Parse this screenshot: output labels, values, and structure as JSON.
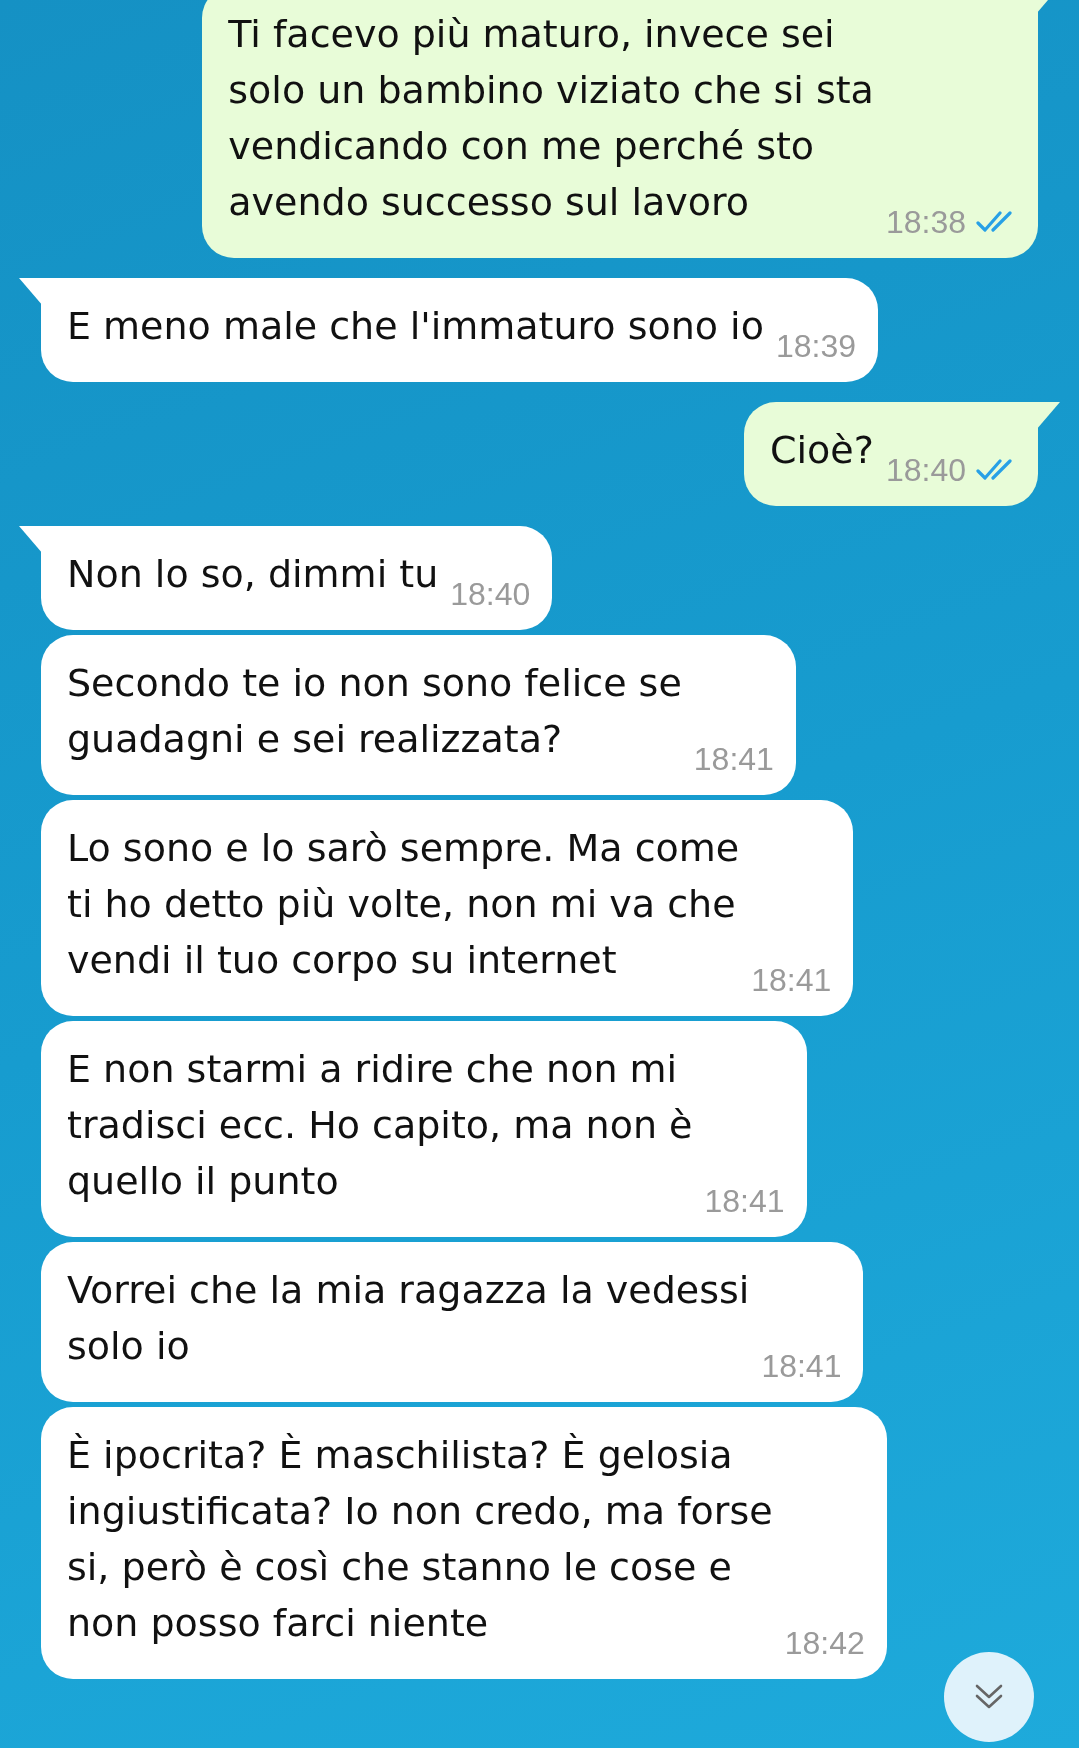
{
  "messages": [
    {
      "kind": "outgoing",
      "tail": true,
      "text": "Ti facevo più maturo, invece sei\nsolo un bambino viziato che si sta\nvendicando con me perché sto\navendo successo sul lavoro",
      "time": "18:38",
      "read": true
    },
    {
      "kind": "incoming",
      "tail": true,
      "text": "E meno male che l'immaturo sono io",
      "time": "18:39"
    },
    {
      "kind": "outgoing",
      "tail": true,
      "text": "Cioè?",
      "time": "18:40",
      "read": true
    },
    {
      "kind": "incoming",
      "tail": true,
      "text": "Non lo so, dimmi tu",
      "time": "18:40"
    },
    {
      "kind": "incoming",
      "tail": false,
      "text": "Secondo te io non sono felice se\nguadagni e sei realizzata?",
      "time": "18:41"
    },
    {
      "kind": "incoming",
      "tail": false,
      "text": "Lo sono e lo sarò sempre. Ma come\nti ho detto più volte, non mi va che\nvendi il tuo corpo su internet",
      "time": "18:41"
    },
    {
      "kind": "incoming",
      "tail": false,
      "text": "E non starmi a ridire che non mi\ntradisci ecc. Ho capito, ma non è\nquello il punto",
      "time": "18:41"
    },
    {
      "kind": "incoming",
      "tail": false,
      "text": "Vorrei che la mia ragazza la vedessi\nsolo io",
      "time": "18:41"
    },
    {
      "kind": "incoming",
      "tail": false,
      "text": "È ipocrita? È maschilista? È gelosia\ningiustificata? Io non credo, ma forse\nsi, però è così che stanno le cose e\nnon posso farci niente",
      "time": "18:42"
    }
  ]
}
